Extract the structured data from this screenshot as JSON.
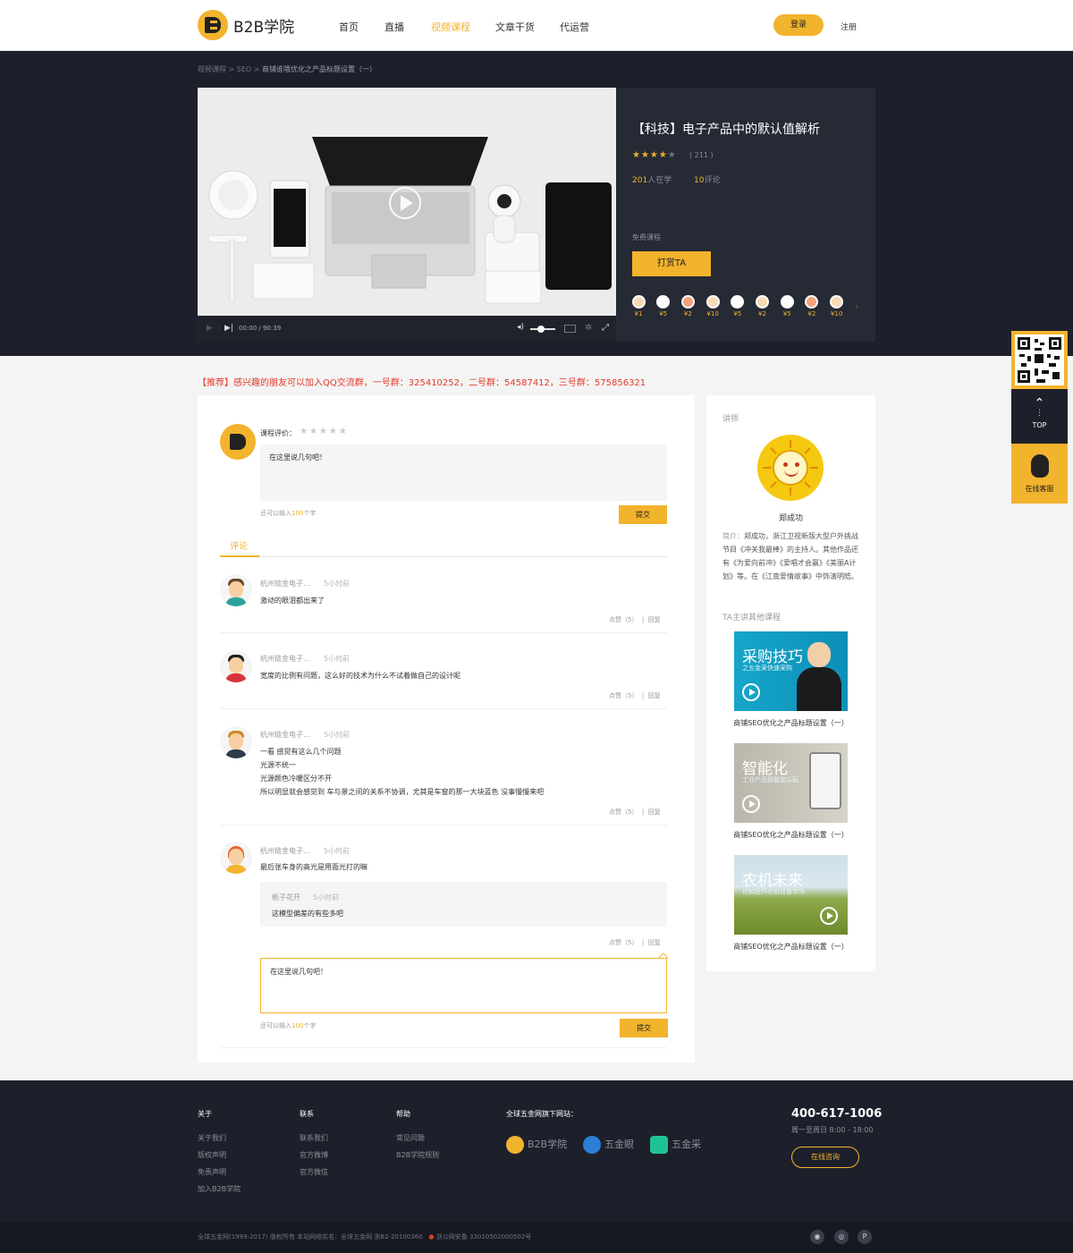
{
  "header": {
    "logo_text": "B2B学院",
    "nav": [
      "首页",
      "直播",
      "视频课程",
      "文章干货",
      "代运营"
    ],
    "login": "登录",
    "register": "注册"
  },
  "banner": {
    "breadcrumb": [
      "视频课程",
      "SEO",
      "商铺谁哦优化之产品标题设置（一）"
    ],
    "player_time": "00:00 / 90:39",
    "course_title": "【科技】电子产品中的默认值解析",
    "rating_count": "( 211 )",
    "learners_num": "201",
    "learners_label": "人在学",
    "comments_num": "10",
    "comments_label": "评论",
    "free_label": "免费课程",
    "tip_button": "打赏TA",
    "tips": [
      "¥1",
      "¥5",
      "¥2",
      "¥10",
      "¥5",
      "¥2",
      "¥5",
      "¥2",
      "¥10"
    ]
  },
  "notice": "【推荐】感兴趣的朋友可以加入QQ交流群，一号群：325410252，二号群：54587412，三号群：575856321",
  "review": {
    "rate_label": "课程评价：",
    "placeholder": "在这里说几句吧！",
    "hint_prefix": "还可以输入",
    "hint_num": "100",
    "hint_suffix": "个字",
    "submit": "提交",
    "tab": "评论"
  },
  "comments": [
    {
      "name": "杭州链金电子...",
      "time": "5小时前",
      "lines": [
        "激动的眼泪都出来了"
      ],
      "likes": "点赞（5）",
      "reply": "回复"
    },
    {
      "name": "杭州链金电子...",
      "time": "5小时前",
      "lines": [
        "宽度的比例有问题，这么好的技术为什么不试着做自己的设计呢"
      ],
      "likes": "点赞（5）",
      "reply": "回复"
    },
    {
      "name": "杭州链金电子...",
      "time": "5小时前",
      "lines": [
        "一看 感觉有这么几个问题",
        "光源不统一",
        "光源颜色冷暖区分不开",
        "所以明显就会感觉到 车与景之间的关系不协调，尤其是车窗的那一大块蓝色  没事慢慢来吧"
      ],
      "likes": "点赞（5）",
      "reply": "回复"
    },
    {
      "name": "杭州链金电子...",
      "time": "5小时前",
      "lines": [
        "最后张车身的高光是用面光打的嘛"
      ],
      "likes": "点赞（5）",
      "reply": "回复",
      "sub_reply": {
        "name": "栀子花开",
        "time": "5小时前",
        "text": "这模型偏差的有些多吧"
      }
    }
  ],
  "reply_box": {
    "placeholder": "在这里说几句吧！",
    "hint_prefix": "还可以输入",
    "hint_num": "100",
    "hint_suffix": "个字",
    "submit": "提交"
  },
  "sidebar": {
    "lecturer_label": "讲师",
    "lecturer_name": "郑成功",
    "intro_key": "简介：",
    "intro": "郑成功，浙江卫视新版大型户外挑战节目《冲关我最棒》的主持人。其他作品还有《为爱向前冲》《爱唱才会赢》《美丽A计划》等。在《江南爱情故事》中饰演明皓。",
    "other_label": "TA主讲其他课程",
    "courses": [
      {
        "thumb_title": "采购技巧",
        "thumb_sub": "之五金采快速采购",
        "caption": "商铺SEO优化之产品标题设置（一）"
      },
      {
        "thumb_title": "智能化",
        "thumb_sub": "工业产品智能怎么玩",
        "caption": "商铺SEO优化之产品标题设置（一）"
      },
      {
        "thumb_title": "农机未来",
        "thumb_sub": "何如运作农机设备市场",
        "caption": "商铺SEO优化之产品标题设置（一）"
      }
    ]
  },
  "float": {
    "top": "TOP",
    "service": "在线客服"
  },
  "footer": {
    "cols": [
      {
        "title": "关于",
        "links": [
          "关于我们",
          "版权声明",
          "免责声明",
          "加入B2B学院"
        ]
      },
      {
        "title": "联系",
        "links": [
          "联系我们",
          "官方微博",
          "官方微信"
        ]
      },
      {
        "title": "帮助",
        "links": [
          "常见问题",
          "B2B学院规则"
        ]
      }
    ],
    "sites_title": "全球五金网旗下网站：",
    "sites": [
      "B2B学院",
      "五金眼",
      "五金采"
    ],
    "phone": "400-617-1006",
    "hours": "周一至周日 8:00 - 18:00",
    "consult": "在线咨询",
    "copyright_a": "全球五金网(1999-2017) 版权所有 本站网络实名：全球五金网 浙B2-20100360",
    "copyright_b": "浙公网安备 33010502000502号"
  },
  "colors": {
    "accent": "#f2b32d",
    "dark": "#1d202a",
    "notice": "#e23a2a"
  }
}
